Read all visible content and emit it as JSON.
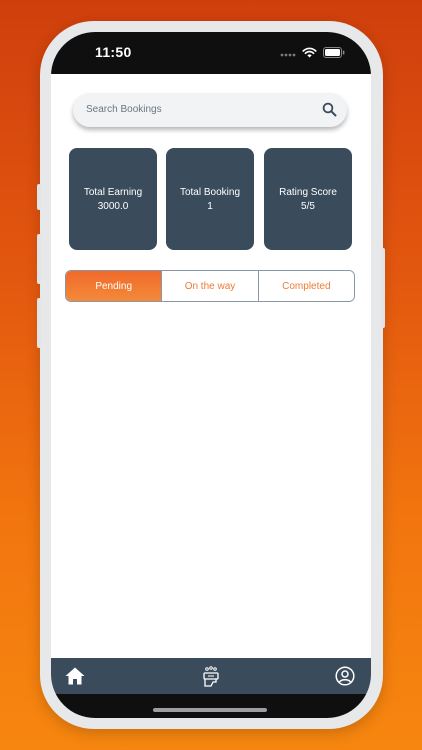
{
  "status_bar": {
    "time": "11:50"
  },
  "search": {
    "placeholder": "Search Bookings"
  },
  "stats": [
    {
      "label": "Total Earning",
      "value": "3000.0"
    },
    {
      "label": "Total Booking",
      "value": "1"
    },
    {
      "label": "Rating Score",
      "value": "5/5"
    }
  ],
  "tabs": [
    {
      "label": "Pending",
      "active": true
    },
    {
      "label": "On the way",
      "active": false
    },
    {
      "label": "Completed",
      "active": false
    }
  ],
  "bottom_nav": [
    {
      "icon": "home-icon",
      "active": true
    },
    {
      "icon": "services-icon",
      "active": false
    },
    {
      "icon": "profile-icon",
      "active": false
    }
  ],
  "colors": {
    "accent": "#f06a2a",
    "card": "#3a4b5c",
    "nav": "#3a4b5c"
  }
}
